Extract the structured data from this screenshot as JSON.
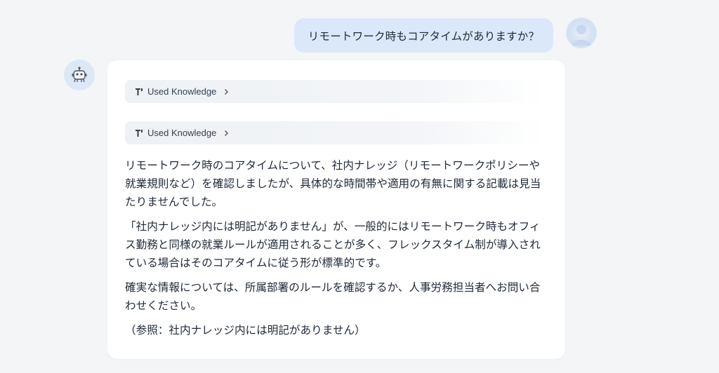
{
  "user": {
    "message": "リモートワーク時もコアタイムがありますか？",
    "avatar": "user-avatar"
  },
  "bot": {
    "avatar": "robot-icon",
    "knowledge": [
      {
        "label": "Used Knowledge",
        "icon": "knowledge-icon"
      },
      {
        "label": "Used Knowledge",
        "icon": "knowledge-icon"
      }
    ],
    "paragraphs": [
      "リモートワーク時のコアタイムについて、社内ナレッジ（リモートワークポリシーや就業規則など）を確認しましたが、具体的な時間帯や適用の有無に関する記載は見当たりませんでした。",
      "「社内ナレッジ内には明記がありません」が、一般的にはリモートワーク時もオフィス勤務と同様の就業ルールが適用されることが多く、フレックスタイム制が導入されている場合はそのコアタイムに従う形が標準的です。",
      "確実な情報については、所属部署のルールを確認するか、人事労務担当者へお問い合わせください。"
    ],
    "reference": "（参照：社内ナレッジ内には明記がありません）"
  },
  "colors": {
    "background": "#f4f5f7",
    "user_bubble": "#dbe8f9",
    "card": "#ffffff",
    "text": "#1f2937"
  }
}
